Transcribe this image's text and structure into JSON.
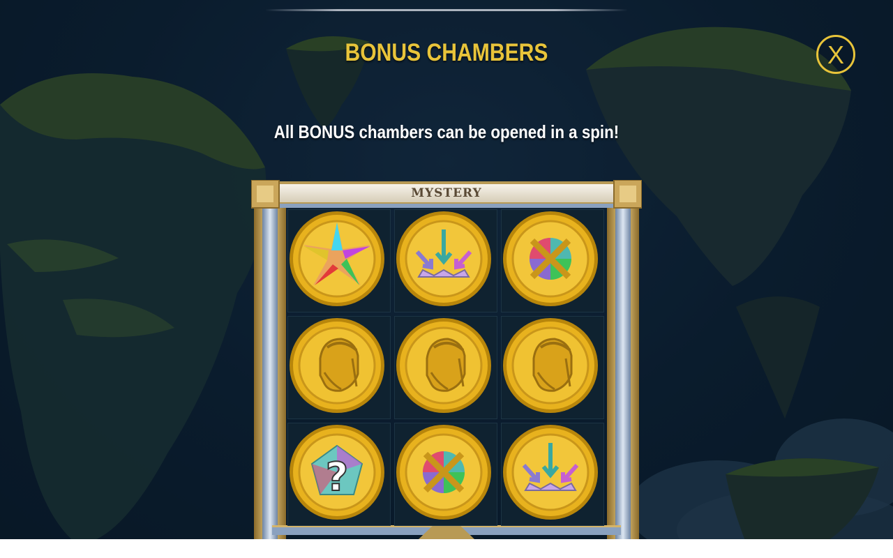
{
  "header": {
    "title": "BONUS CHAMBERS",
    "subtitle": "All BONUS chambers can be opened in a spin!",
    "close_label": "X"
  },
  "panel": {
    "banner": "MYSTERY",
    "rows": [
      [
        "star-gem-icon",
        "arrow-crown-icon",
        "crossed-swords-gem-icon"
      ],
      [
        "bearded-warrior-icon",
        "bearded-warrior-icon",
        "bearded-warrior-icon"
      ],
      [
        "mystery-question-icon",
        "crossed-swords-gem-icon",
        "arrow-crown-icon"
      ]
    ]
  },
  "colors": {
    "title": "#e8c43a",
    "subtitle": "#ffffff",
    "close": "#e8c43a",
    "coin_gold": "#e8b21e",
    "frame_gold": "#d4b46a",
    "frame_steel": "#a9bbd3"
  }
}
